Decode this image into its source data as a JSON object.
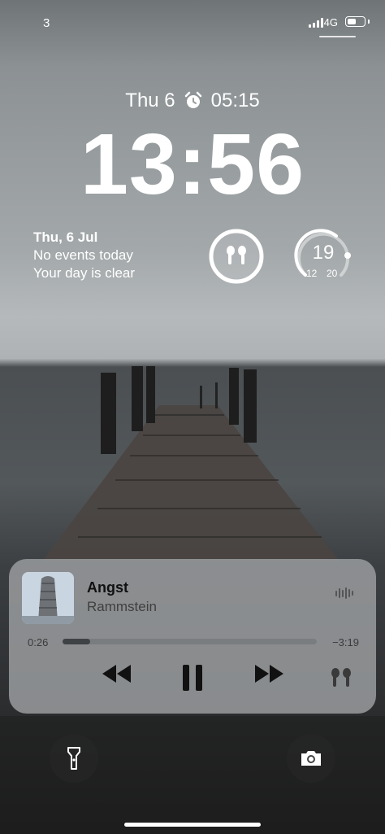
{
  "status": {
    "carrier": "3",
    "network": "4G",
    "signal_bars": 4,
    "battery_level": 0.55
  },
  "lock": {
    "date_short": "Thu 6",
    "alarm_time": "05:15",
    "time": "13:56"
  },
  "widgets": {
    "calendar": {
      "date": "Thu, 6 Jul",
      "line1": "No events today",
      "line2": "Your day is clear"
    },
    "airpods": {
      "icon": "airpods-icon"
    },
    "weather": {
      "temp": "19",
      "low": "12",
      "high": "20"
    }
  },
  "now_playing": {
    "title": "Angst",
    "artist": "Rammstein",
    "elapsed": "0:26",
    "remaining": "−3:19",
    "progress": 0.11
  },
  "bottom": {
    "left_icon": "flashlight-icon",
    "right_icon": "camera-icon"
  }
}
